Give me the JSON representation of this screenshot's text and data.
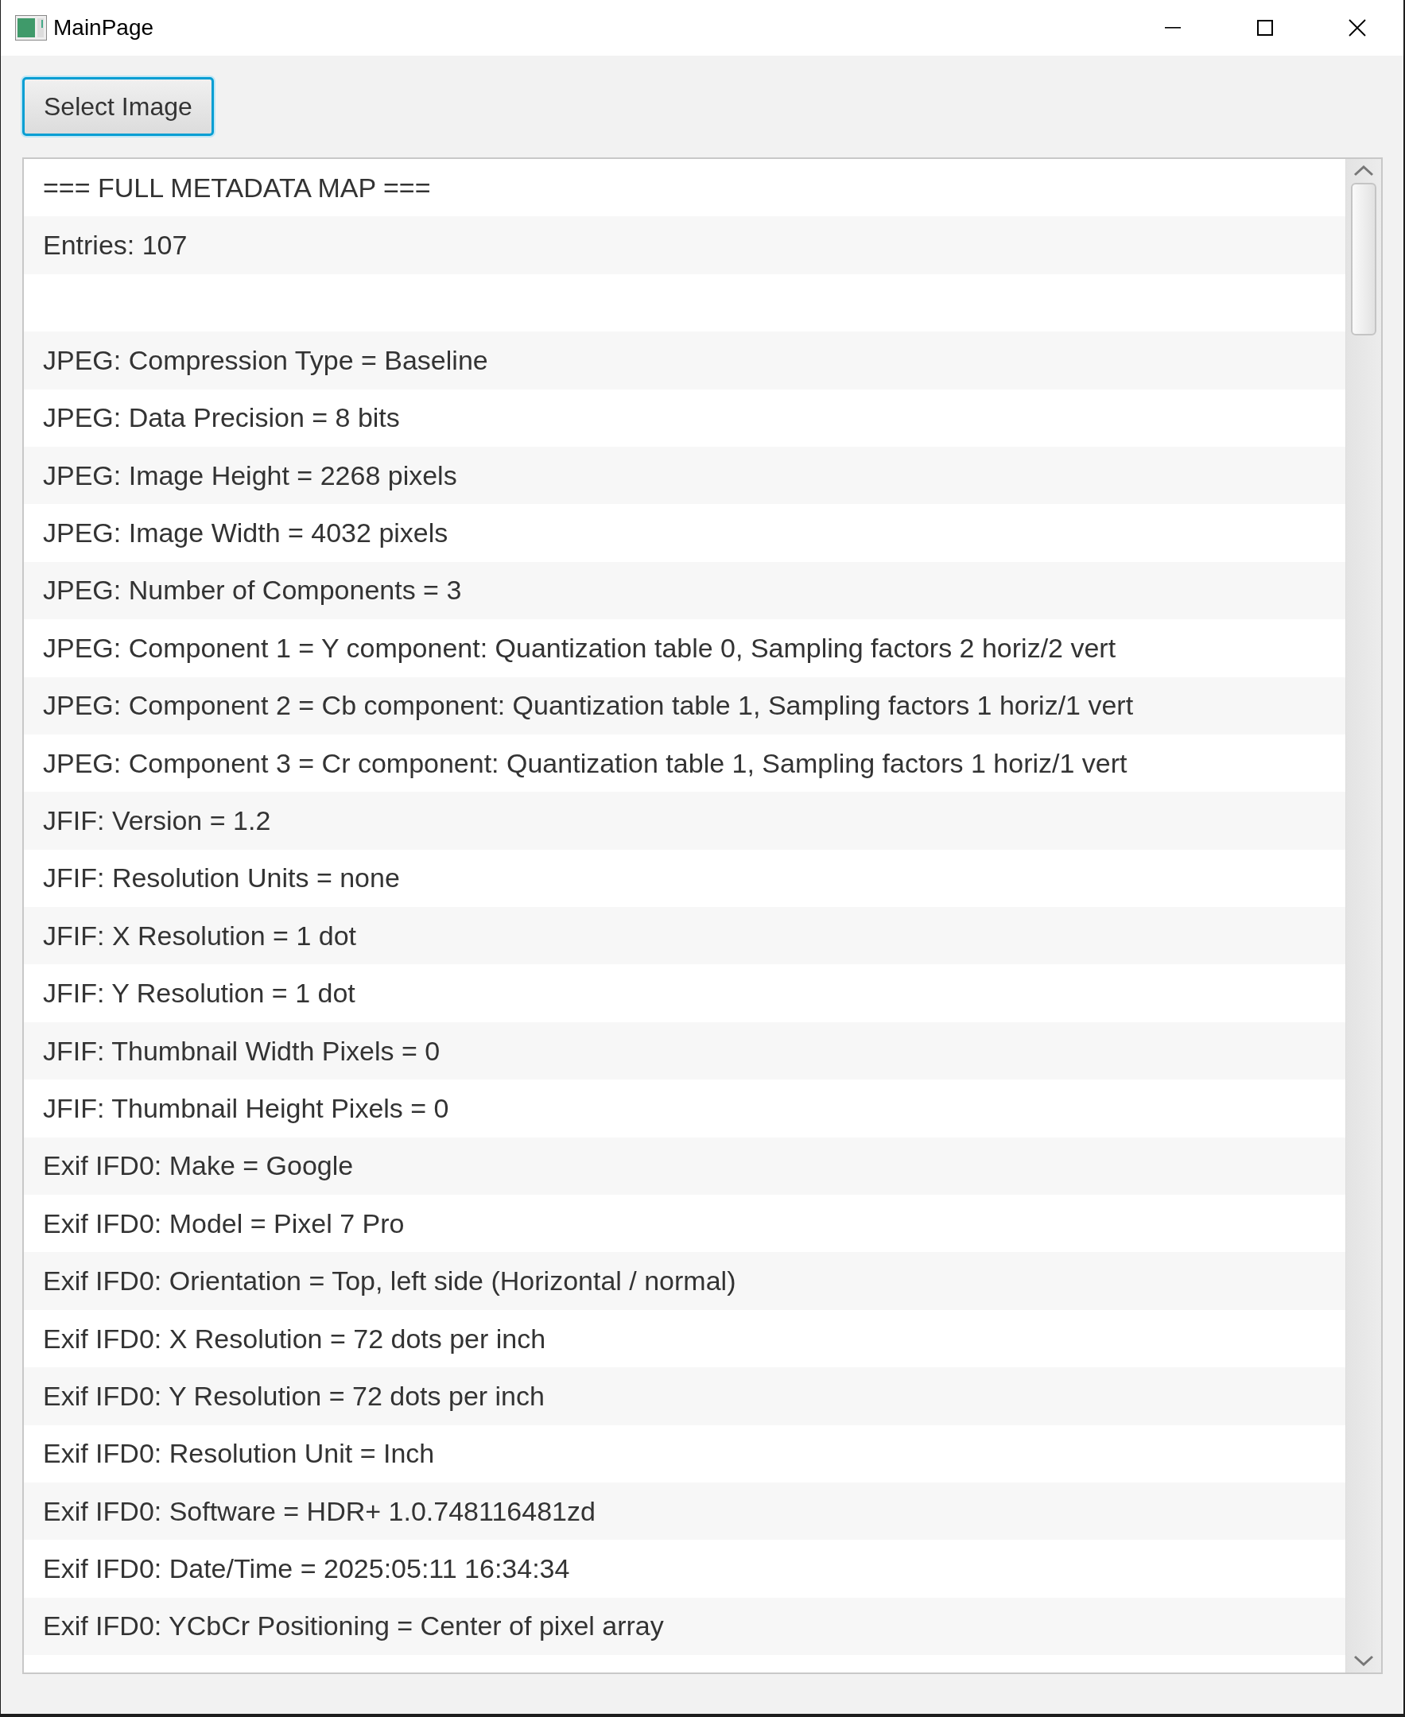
{
  "window": {
    "title": "MainPage"
  },
  "select_button": {
    "label": "Select Image",
    "focused": true
  },
  "list": {
    "rows": [
      {
        "kind": "text",
        "text": "=== FULL METADATA MAP ==="
      },
      {
        "kind": "text",
        "text": "Entries: 107"
      },
      {
        "kind": "blank"
      },
      {
        "kind": "text",
        "text": "JPEG: Compression Type = Baseline"
      },
      {
        "kind": "text",
        "text": "JPEG: Data Precision = 8 bits"
      },
      {
        "kind": "text",
        "text": "JPEG: Image Height = 2268 pixels"
      },
      {
        "kind": "text",
        "text": "JPEG: Image Width = 4032 pixels"
      },
      {
        "kind": "text",
        "text": "JPEG: Number of Components = 3"
      },
      {
        "kind": "text",
        "text": "JPEG: Component 1 = Y component: Quantization table 0, Sampling factors 2 horiz/2 vert"
      },
      {
        "kind": "text",
        "text": "JPEG: Component 2 = Cb component: Quantization table 1, Sampling factors 1 horiz/1 vert"
      },
      {
        "kind": "text",
        "text": "JPEG: Component 3 = Cr component: Quantization table 1, Sampling factors 1 horiz/1 vert"
      },
      {
        "kind": "text",
        "text": "JFIF: Version = 1.2"
      },
      {
        "kind": "text",
        "text": "JFIF: Resolution Units = none"
      },
      {
        "kind": "text",
        "text": "JFIF: X Resolution = 1 dot"
      },
      {
        "kind": "text",
        "text": "JFIF: Y Resolution = 1 dot"
      },
      {
        "kind": "text",
        "text": "JFIF: Thumbnail Width Pixels = 0"
      },
      {
        "kind": "text",
        "text": "JFIF: Thumbnail Height Pixels = 0"
      },
      {
        "kind": "text",
        "text": "Exif IFD0: Make = Google"
      },
      {
        "kind": "text",
        "text": "Exif IFD0: Model = Pixel 7 Pro"
      },
      {
        "kind": "text",
        "text": "Exif IFD0: Orientation = Top, left side (Horizontal / normal)"
      },
      {
        "kind": "text",
        "text": "Exif IFD0: X Resolution = 72 dots per inch"
      },
      {
        "kind": "text",
        "text": "Exif IFD0: Y Resolution = 72 dots per inch"
      },
      {
        "kind": "text",
        "text": "Exif IFD0: Resolution Unit = Inch"
      },
      {
        "kind": "text",
        "text": "Exif IFD0: Software = HDR+ 1.0.748116481zd"
      },
      {
        "kind": "text",
        "text": "Exif IFD0: Date/Time = 2025:05:11 16:34:34"
      },
      {
        "kind": "text",
        "text": "Exif IFD0: YCbCr Positioning = Center of pixel array"
      }
    ]
  }
}
